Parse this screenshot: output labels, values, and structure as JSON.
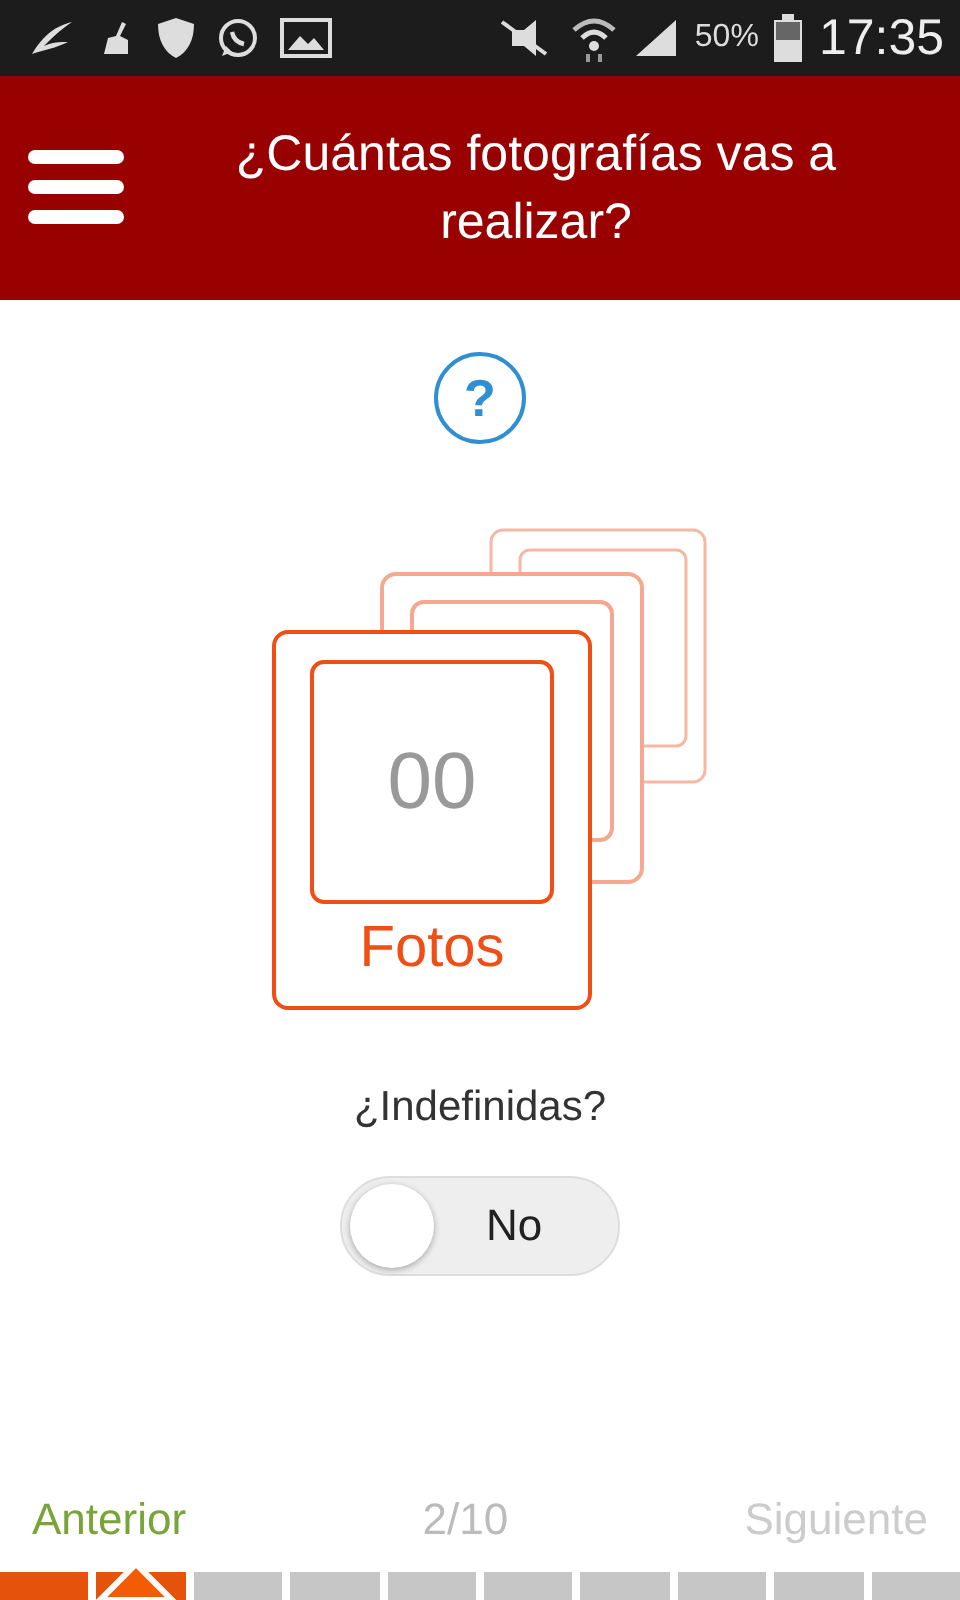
{
  "status_bar": {
    "battery": "50%",
    "time": "17:35"
  },
  "header": {
    "title": "¿Cuántas fotografías vas a realizar?"
  },
  "help": {
    "label": "?"
  },
  "counter": {
    "value": "00",
    "unit": "Fotos"
  },
  "indefinite": {
    "label": "¿Indefinidas?",
    "toggle": {
      "text": "No",
      "on": false
    }
  },
  "nav": {
    "previous": "Anterior",
    "position": "2/10",
    "next": "Siguiente",
    "next_disabled": true
  },
  "steps": [
    {
      "done": true,
      "selected": false
    },
    {
      "done": true,
      "selected": true
    },
    {
      "done": false,
      "selected": false
    },
    {
      "done": false,
      "selected": false
    },
    {
      "done": false,
      "selected": false
    },
    {
      "done": false,
      "selected": false
    },
    {
      "done": false,
      "selected": false
    },
    {
      "done": false,
      "selected": false
    },
    {
      "done": false,
      "selected": false
    },
    {
      "done": false,
      "selected": false
    }
  ]
}
